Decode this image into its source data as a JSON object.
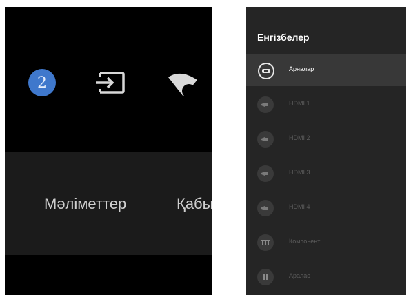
{
  "left_screen": {
    "badge": "2",
    "icons": [
      "input-source-icon",
      "wifi-icon"
    ],
    "band_labels": [
      "Мәліметтер",
      "Қабы"
    ]
  },
  "panel": {
    "title": "Енгізбелер",
    "items": [
      {
        "label": "Арналар",
        "icon": "tv-channels-icon",
        "state": "selected"
      },
      {
        "label": "HDMI 1",
        "icon": "hdmi-icon",
        "state": "inactive"
      },
      {
        "label": "HDMI 2",
        "icon": "hdmi-icon",
        "state": "inactive"
      },
      {
        "label": "HDMI 3",
        "icon": "hdmi-icon",
        "state": "inactive"
      },
      {
        "label": "HDMI 4",
        "icon": "hdmi-icon",
        "state": "inactive"
      },
      {
        "label": "Компонент",
        "icon": "component-icon",
        "state": "inactive"
      },
      {
        "label": "Аралас",
        "icon": "composite-icon",
        "state": "inactive"
      }
    ]
  },
  "colors": {
    "badge": "#3f78cc",
    "panel_bg": "#252525",
    "selected_row": "#383838",
    "inactive_text": "#5c5c5c"
  }
}
